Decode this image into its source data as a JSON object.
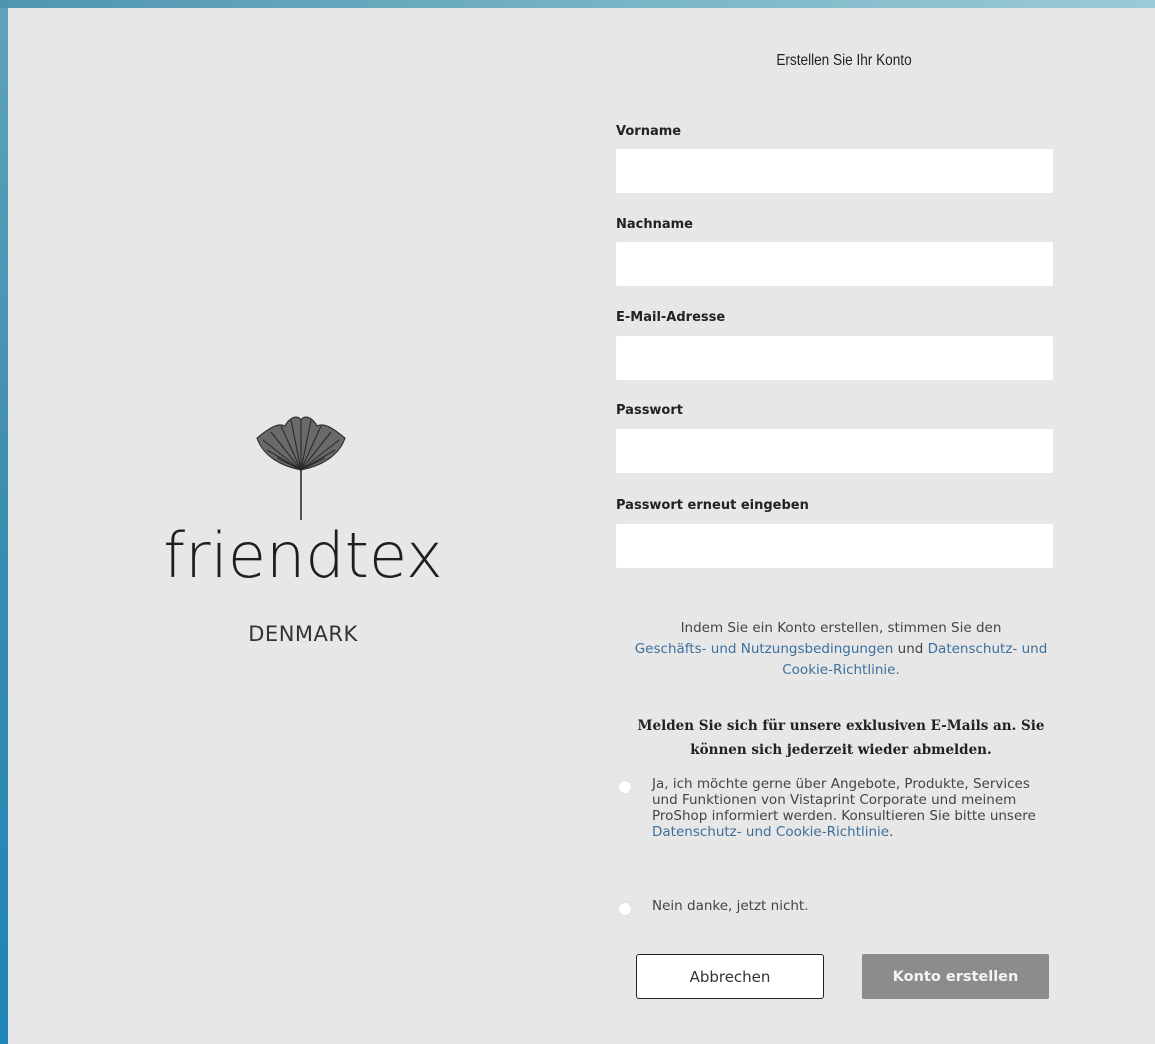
{
  "brand": {
    "name": "friendtex",
    "sub": "DENMARK"
  },
  "form": {
    "title": "Erstellen Sie Ihr Konto",
    "fields": [
      {
        "label": "Vorname",
        "value": "",
        "placeholder": ""
      },
      {
        "label": "Nachname",
        "value": "",
        "placeholder": ""
      },
      {
        "label": "E-Mail-Adresse",
        "value": "",
        "placeholder": ""
      },
      {
        "label": "Passwort",
        "value": "",
        "placeholder": ""
      },
      {
        "label": "Passwort erneut eingeben",
        "value": "",
        "placeholder": ""
      }
    ]
  },
  "terms": {
    "text_before": "Indem Sie ein Konto erstellen, stimmen Sie den",
    "link_terms": "Geschäfts- und Nutzungsbedingungen",
    "text_and": "und",
    "link_privacy": "Datenschutz- und Cookie-Richtlinie."
  },
  "newsletter": {
    "heading": "Melden Sie sich für unsere exklusiven E-Mails an. Sie können sich jederzeit wieder abmelden.",
    "option_yes_text": "Ja, ich möchte gerne über Angebote, Produkte, Services und Funktionen von Vistaprint Corporate und meinem ProShop informiert werden. Konsultieren Sie bitte unsere",
    "option_yes_link": "Datenschutz- und Cookie-Richtlinie",
    "option_yes_suffix": ".",
    "option_no_text": "Nein danke, jetzt nicht."
  },
  "buttons": {
    "cancel": "Abbrechen",
    "create": "Konto erstellen"
  },
  "colors": {
    "panel_bg": "#e7e7e7",
    "link": "#3d6f9c",
    "create_button_bg": "#8c8c8c",
    "frame_accent": "#1e85b8"
  }
}
